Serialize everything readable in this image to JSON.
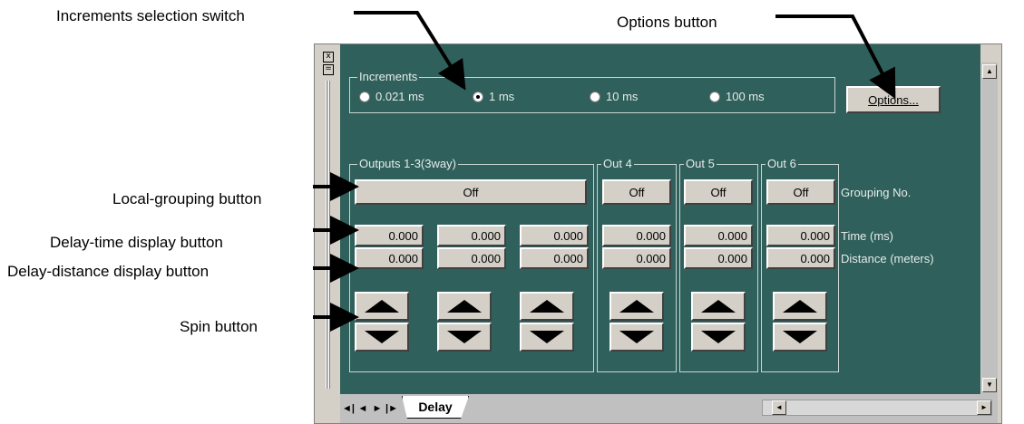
{
  "callouts": {
    "increments_switch": "Increments selection switch",
    "options_button": "Options button",
    "local_grouping": "Local-grouping button",
    "delay_time": "Delay-time display button",
    "delay_distance": "Delay-distance display button",
    "spin": "Spin button"
  },
  "window": {
    "close_glyph": "x",
    "restore_glyph": "="
  },
  "increments": {
    "label": "Increments",
    "options": [
      "0.021 ms",
      "1 ms",
      "10 ms",
      "100 ms"
    ],
    "selected": "1 ms"
  },
  "options_label": "Options...",
  "groups": {
    "outputs_1_3": "Outputs 1-3(3way)",
    "out4": "Out 4",
    "out5": "Out 5",
    "out6": "Out 6"
  },
  "grouping": {
    "main": "Off",
    "out4": "Off",
    "out5": "Off",
    "out6": "Off"
  },
  "time_values": [
    "0.000",
    "0.000",
    "0.000",
    "0.000",
    "0.000",
    "0.000"
  ],
  "distance_values": [
    "0.000",
    "0.000",
    "0.000",
    "0.000",
    "0.000",
    "0.000"
  ],
  "row_labels": {
    "grouping": "Grouping No.",
    "time": "Time (ms)",
    "distance": "Distance (meters)"
  },
  "nav": {
    "first": "◄|",
    "prev": "◄",
    "next": "►",
    "last": "|►"
  },
  "tab_label": "Delay",
  "scroll": {
    "up": "▲",
    "down": "▼",
    "left": "◄",
    "right": "►"
  }
}
